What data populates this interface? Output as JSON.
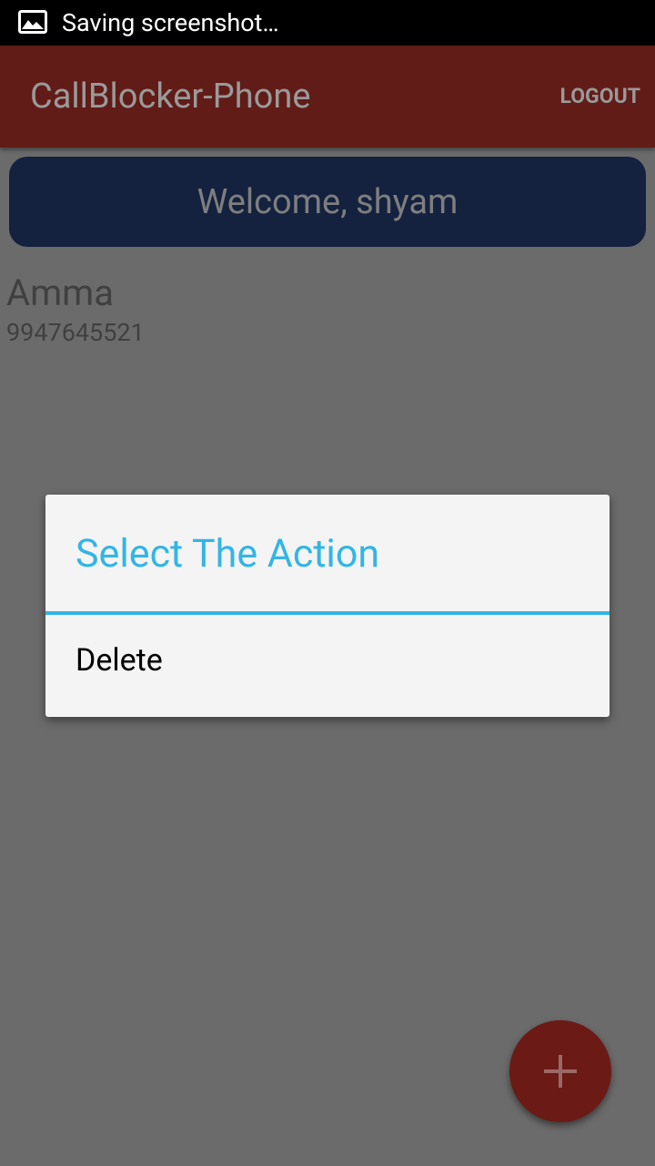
{
  "status_bar": {
    "text": "Saving screenshot…",
    "icon": "image-icon"
  },
  "app_bar": {
    "title": "CallBlocker-Phone",
    "logout_label": "LOGOUT",
    "color": "#611c17"
  },
  "welcome": {
    "text": "Welcome, shyam",
    "color": "#14223f"
  },
  "contacts": [
    {
      "name": "Amma",
      "number": "9947645521"
    }
  ],
  "dialog": {
    "title": "Select The Action",
    "accent": "#33b5e5",
    "options": [
      {
        "label": "Delete"
      }
    ]
  },
  "fab": {
    "icon": "plus-icon"
  }
}
